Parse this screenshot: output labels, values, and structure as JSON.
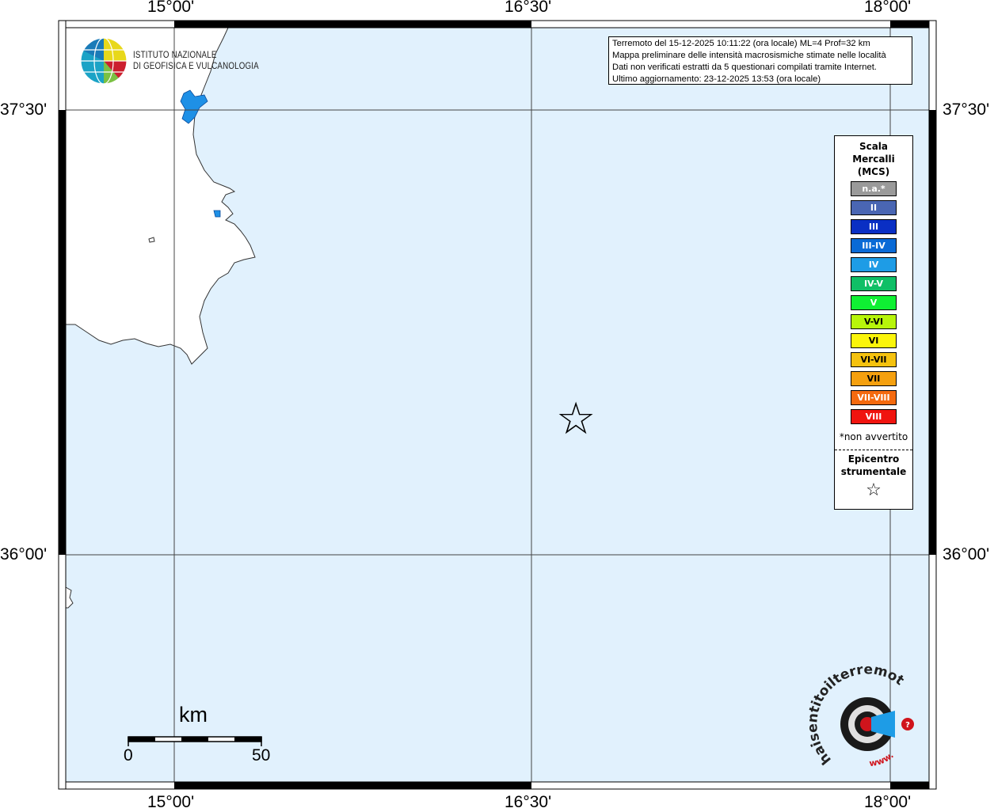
{
  "coordinates": {
    "lon_ticks": [
      "15°00'",
      "16°30'",
      "18°00'"
    ],
    "lat_ticks": [
      "37°30'",
      "36°00'"
    ]
  },
  "logo": {
    "line1": "ISTITUTO NAZIONALE",
    "line2": "DI GEOFISICA E VULCANOLOGIA"
  },
  "info": {
    "line1": "Terremoto del 15-12-2025 10:11:22 (ora locale) ML=4 Prof=32 km",
    "line2": "Mappa preliminare delle intensità macrosismiche stimate nelle località",
    "line3": "Dati non verificati estratti da 5 questionari compilati tramite Internet.",
    "line4": "Ultimo aggiornamento: 23-12-2025 13:53 (ora locale)"
  },
  "legend": {
    "title_line1": "Scala",
    "title_line2": "Mercalli",
    "title_line3": "(MCS)",
    "items": [
      {
        "label": "n.a.*",
        "color": "#9a9a9a"
      },
      {
        "label": "II",
        "color": "#4a66b3"
      },
      {
        "label": "III",
        "color": "#0a2fc4"
      },
      {
        "label": "III-IV",
        "color": "#0a6ad6"
      },
      {
        "label": "IV",
        "color": "#1e9ce6"
      },
      {
        "label": "IV-V",
        "color": "#0fbf66"
      },
      {
        "label": "V",
        "color": "#0ff033"
      },
      {
        "label": "V-VI",
        "color": "#b7f50a"
      },
      {
        "label": "VI",
        "color": "#fbf50a"
      },
      {
        "label": "VI-VII",
        "color": "#f5c20f"
      },
      {
        "label": "VII",
        "color": "#f5a00f"
      },
      {
        "label": "VII-VIII",
        "color": "#f56a0f"
      },
      {
        "label": "VIII",
        "color": "#f0140f"
      }
    ],
    "note": "*non avvertito",
    "epicenter_line1": "Epicentro",
    "epicenter_line2": "strumentale",
    "epicenter_symbol": "☆"
  },
  "epicenter_marker": "☆",
  "scale_bar": {
    "unit": "km",
    "start": "0",
    "end": "50"
  },
  "watermark": {
    "text": "haisentitoilterremoto.it",
    "prefix": "www."
  },
  "colors": {
    "sea": "#e1f1fd",
    "land": "#ffffff",
    "water_body": "#1e90e6"
  }
}
